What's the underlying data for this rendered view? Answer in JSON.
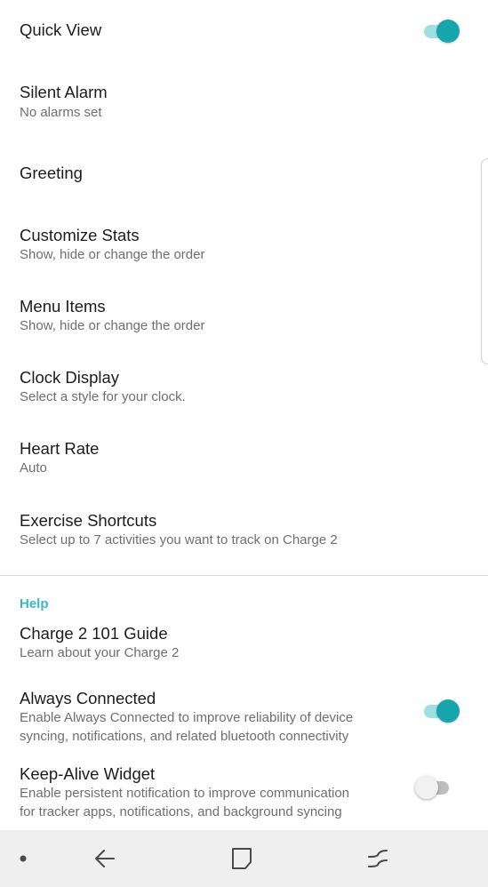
{
  "settings": {
    "quick_view": {
      "title": "Quick View",
      "enabled": true
    },
    "silent_alarm": {
      "title": "Silent Alarm",
      "subtitle": "No alarms set"
    },
    "greeting": {
      "title": "Greeting"
    },
    "customize_stats": {
      "title": "Customize Stats",
      "subtitle": "Show, hide or change the order"
    },
    "menu_items": {
      "title": "Menu Items",
      "subtitle": "Show, hide or change the order"
    },
    "clock_display": {
      "title": "Clock Display",
      "subtitle": "Select a style for your clock."
    },
    "heart_rate": {
      "title": "Heart Rate",
      "subtitle": "Auto"
    },
    "exercise_shortcuts": {
      "title": "Exercise Shortcuts",
      "subtitle": "Select up to 7 activities you want to track on Charge 2"
    }
  },
  "help": {
    "header": "Help",
    "guide": {
      "title": "Charge 2 101 Guide",
      "subtitle": "Learn about your Charge 2"
    },
    "always_connected": {
      "title": "Always Connected",
      "subtitle_line1": "Enable Always Connected to improve reliability of device",
      "subtitle_line2": "syncing, notifications, and related bluetooth connectivity",
      "enabled": true
    },
    "keep_alive": {
      "title": "Keep-Alive Widget",
      "subtitle_line1": "Enable persistent notification to improve communication",
      "subtitle_line2": "for tracker apps, notifications, and background syncing",
      "enabled": false
    }
  },
  "navbar": {
    "icons": [
      "dot-icon",
      "back-arrow-icon",
      "home-square-icon",
      "recent-apps-icon"
    ]
  },
  "colors": {
    "accent": "#16a5ad",
    "accent_track": "#9fdfe2",
    "section_header": "#3cb7c1",
    "subtitle": "#6f6f6f",
    "navbar_bg": "#efefef"
  }
}
